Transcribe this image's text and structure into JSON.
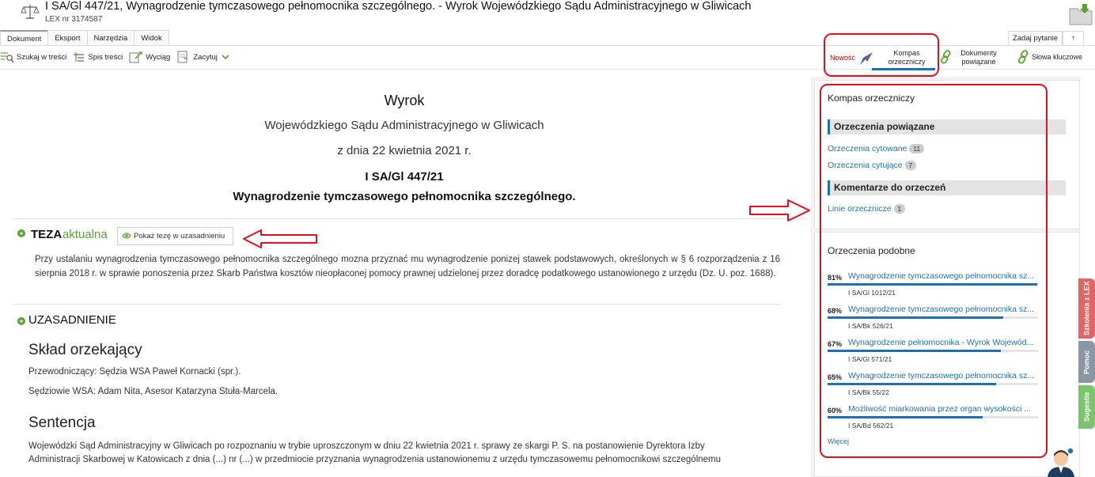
{
  "header": {
    "title": "I SA/Gl 447/21, Wynagrodzenie tymczasowego pełnomocnika szczególnego. - Wyrok Wojewódzkiego Sądu Administracyjnego w Gliwicach",
    "lex_nr": "LEX nr 3174587"
  },
  "tabs": [
    "Dokument",
    "Eksport",
    "Narzędzia",
    "Widok"
  ],
  "toolbar": {
    "search": "Szukaj w treści",
    "toc": "Spis treści",
    "extract": "Wyciąg",
    "cite": "Zacytuj"
  },
  "top_right": {
    "ask": "Zadaj pytanie",
    "up": "↑"
  },
  "right_toolbar": {
    "new": "Nowość",
    "kompas_l1": "Kompas",
    "kompas_l2": "orzeczniczy",
    "dok_l1": "Dokumenty",
    "dok_l2": "powiązane",
    "keywords": "Słowa kluczowe"
  },
  "document": {
    "heading": "Wyrok",
    "court": "Wojewódzkiego Sądu Administracyjnego w Gliwicach",
    "date": "z dnia 22 kwietnia 2021 r.",
    "signature": "I SA/Gl 447/21",
    "subject": "Wynagrodzenie tymczasowego pełnomocnika szczególnego.",
    "teza_label": "TEZA",
    "teza_status": "aktualna",
    "show_teza": "Pokaż tezę w uzasadnieniu",
    "teza_text": "Przy ustalaniu wynagrodzenia tymczasowego pełnomocnika szczególnego mozna przyznać mu wynagrodzenie ponizej stawek podstawowych, określonych w § 6 rozporządzenia z 16 sierpnia 2018 r. w sprawie ponoszenia przez Skarb Państwa kosztów nieopłaconej pomocy prawnej udzielonej przez doradcę podatkowego ustanowionego z urzędu (Dz. U. poz. 1688).",
    "uzasadnienie": "UZASADNIENIE",
    "sklad_heading": "Skład orzekający",
    "przewodniczacy": "Przewodniczący: Sędzia WSA Paweł Kornacki (spr.).",
    "sedziowie": "Sędziowie WSA: Adam Nita, Asesor Katarzyna Stuła-Marcela.",
    "sentencja_heading": "Sentencja",
    "sentencja_l1": "Wojewódzki Sąd Administracyjny w Gliwicach po rozpoznaniu w trybie uproszczonym w dniu 22 kwietnia 2021 r. sprawy ze skargi P. S. na postanowienie Dyrektora Izby",
    "sentencja_l2": "Administracji Skarbowej w Katowicach z dnia (...) nr (...) w przedmiocie przyznania wynagrodzenia ustanowionemu z urzędu tymczasowemu pełnomocnikowi szczególnemu"
  },
  "kompas": {
    "title": "Kompas orzeczniczy",
    "section1": "Orzeczenia powiązane",
    "cytowane": "Orzeczenia cytowane",
    "cytowane_count": "11",
    "cytujace": "Orzeczenia cytujące",
    "cytujace_count": "7",
    "section2": "Komentarze do orzeczeń",
    "linie": "Linie orzecznicze",
    "linie_count": "1"
  },
  "podobne": {
    "title": "Orzeczenia podobne",
    "items": [
      {
        "pct": "81%",
        "pct_value": 81,
        "title": "Wynagrodzenie tymczasowego pełnomocnika sz...",
        "sign": "I SA/Gl 1012/21"
      },
      {
        "pct": "68%",
        "pct_value": 68,
        "title": "Wynagrodzenie tymczasowego pełnomocnika sz...",
        "sign": "I SA/Bk 526/21"
      },
      {
        "pct": "67%",
        "pct_value": 67,
        "title": "Wynagrodzenie pełnomocnika - Wyrok Wojewód...",
        "sign": "I SA/Gl 571/21"
      },
      {
        "pct": "65%",
        "pct_value": 65,
        "title": "Wynagrodzenie tymczasowego pełnomocnika sz...",
        "sign": "I SA/Bk 55/22"
      },
      {
        "pct": "60%",
        "pct_value": 60,
        "title": "Możliwość miarkowania przez organ wysokości ...",
        "sign": "I SA/Bd 562/21"
      }
    ],
    "more": "Więcej"
  },
  "side_tabs": {
    "szkolenia": "Szkolenia z LEX",
    "pomoc": "Pomoc",
    "sugestie": "Sugestie"
  },
  "colors": {
    "accent": "#1f6fb2",
    "green": "#5aa135",
    "annotation_red": "#e0101f"
  }
}
